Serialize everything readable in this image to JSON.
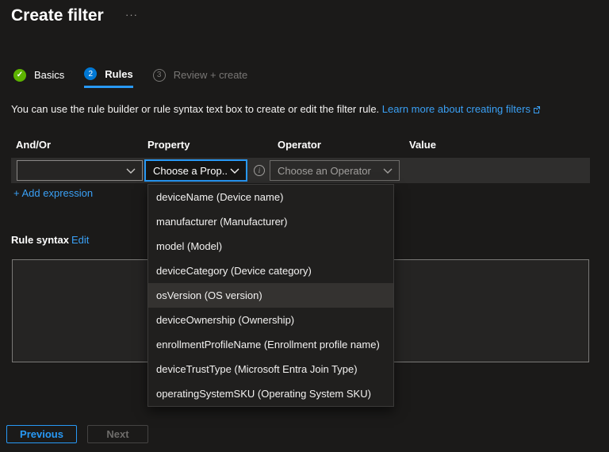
{
  "page": {
    "title": "Create filter"
  },
  "icons": {
    "overflow": "···",
    "check": "✓",
    "info": "i"
  },
  "steps": [
    {
      "label": "Basics",
      "state": "complete"
    },
    {
      "label": "Rules",
      "state": "active",
      "number": "2"
    },
    {
      "label": "Review + create",
      "state": "upcoming",
      "number": "3"
    }
  ],
  "intro": {
    "text": "You can use the rule builder or rule syntax text box to create or edit the filter rule.",
    "link": "Learn more about creating filters"
  },
  "rule_builder": {
    "columns": {
      "andor": "And/Or",
      "property": "Property",
      "operator": "Operator",
      "value": "Value"
    },
    "row": {
      "andor_value": "",
      "property_placeholder": "Choose a Prop...",
      "operator_placeholder": "Choose an Operator"
    },
    "add_expression": "+ Add expression"
  },
  "rule_syntax": {
    "label": "Rule syntax",
    "edit": "Edit",
    "value": ""
  },
  "property_menu": {
    "items": [
      {
        "label": "deviceName (Device name)",
        "highlighted": false
      },
      {
        "label": "manufacturer (Manufacturer)",
        "highlighted": false
      },
      {
        "label": "model (Model)",
        "highlighted": false
      },
      {
        "label": "deviceCategory (Device category)",
        "highlighted": false
      },
      {
        "label": "osVersion (OS version)",
        "highlighted": true
      },
      {
        "label": "deviceOwnership (Ownership)",
        "highlighted": false
      },
      {
        "label": "enrollmentProfileName (Enrollment profile name)",
        "highlighted": false
      },
      {
        "label": "deviceTrustType (Microsoft Entra Join Type)",
        "highlighted": false
      },
      {
        "label": "operatingSystemSKU (Operating System SKU)",
        "highlighted": false
      }
    ]
  },
  "footer": {
    "previous": "Previous",
    "next": "Next"
  },
  "colors": {
    "background": "#1b1a19",
    "row_background": "#2f2e2d",
    "accent_blue": "#0078d4",
    "focus_blue": "#2899f5",
    "link_blue": "#3aa0f5",
    "success_green": "#5db300",
    "disabled_gray": "#797775",
    "menu_highlight": "#343230"
  }
}
